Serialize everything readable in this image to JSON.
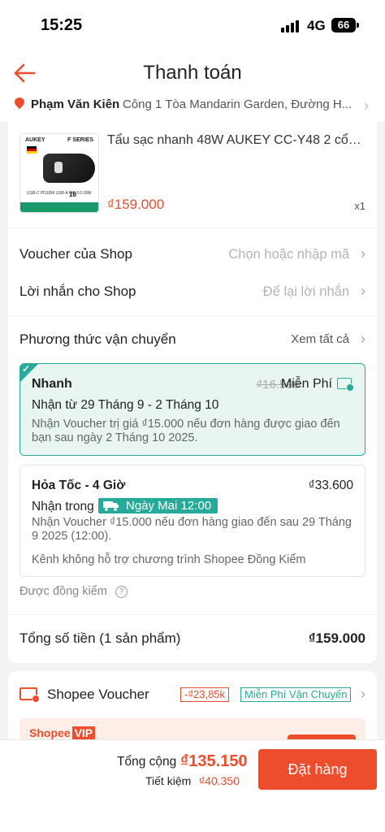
{
  "status": {
    "time": "15:25",
    "network": "4G",
    "battery": "66"
  },
  "header": {
    "title": "Thanh toán"
  },
  "address": {
    "name": "Phạm Văn Kiên",
    "text": "Công 1 Tòa Mandarin Garden, Đường H..."
  },
  "product": {
    "image": {
      "brand": "AUKEY",
      "series": "F SERIES",
      "spec": "USB-C PD18W  USB-A QC 3.0 18W",
      "watt": "18"
    },
    "title": "Tẩu sạc nhanh 48W AUKEY CC-Y48 2 cổng...",
    "price": "₫159.000",
    "qty": "x1"
  },
  "shop_voucher": {
    "label": "Voucher của Shop",
    "value": "Chọn hoặc nhập mã"
  },
  "shop_message": {
    "label": "Lời nhắn cho Shop",
    "value": "Để lại lời nhắn"
  },
  "shipping": {
    "title": "Phương thức vận chuyển",
    "see_all": "Xem tất cả",
    "options": [
      {
        "name": "Nhanh",
        "old_price": "₫16.500",
        "price": "Miễn Phí",
        "date": "Nhận từ 29 Tháng 9 - 2 Tháng 10",
        "note": "Nhận Voucher trị giá ₫15.000 nếu đơn hàng được giao đến bạn sau ngày 2 Tháng 10 2025."
      },
      {
        "name": "Hỏa Tốc - 4 Giờ",
        "price": "₫33.600",
        "receive_label": "Nhận trong",
        "badge": "Ngày Mai 12:00",
        "note": "Nhận Voucher ₫15.000 nếu đơn hàng giao đến sau 29 Tháng 9 2025 (12:00).",
        "note2": "Kênh không hỗ trợ chương trình Shopee Đồng Kiểm"
      }
    ],
    "verified": "Được đồng kiểm"
  },
  "order_total": {
    "label": "Tổng số tiền (1 sản phẩm)",
    "value": "₫159.000"
  },
  "shopee_voucher": {
    "label": "Shopee Voucher",
    "tag_discount": "-₫23,85k",
    "tag_freeship": "Miễn Phí Vận Chuyển",
    "vip_logo": "Shopee",
    "vip_badge": "VIP"
  },
  "footer": {
    "total_label": "Tổng cộng",
    "total_value": "₫135.150",
    "save_label": "Tiết kiệm",
    "save_value": "₫40.350",
    "order_button": "Đặt hàng"
  },
  "colors": {
    "accent": "#ee4d2d",
    "teal": "#26aa99"
  }
}
